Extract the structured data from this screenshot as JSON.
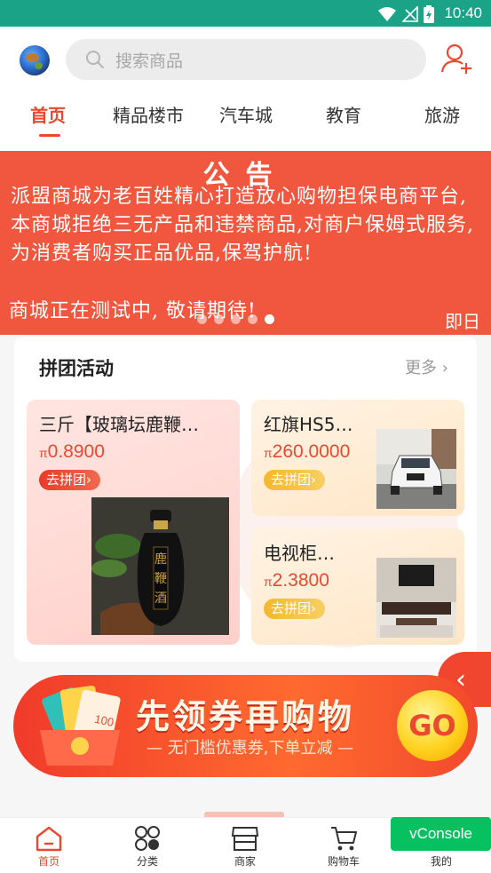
{
  "status_bar": {
    "time": "10:40"
  },
  "header": {
    "search_placeholder": "搜索商品"
  },
  "tabs": [
    {
      "label": "首页",
      "active": true
    },
    {
      "label": "精品楼市"
    },
    {
      "label": "汽车城"
    },
    {
      "label": "教育"
    },
    {
      "label": "旅游"
    }
  ],
  "banner": {
    "title": "公告",
    "text": "派盟商城为老百姓精心打造放心购物担保电商平台,本商城拒绝三无产品和违禁商品,对商户保姆式服务, 为消费者购买正品优品,保驾护航!",
    "text2": "商城正在测试中, 敬请期待!",
    "sign": "即日",
    "slides": 5,
    "active_slide": 5
  },
  "group_buy": {
    "title": "拼团活动",
    "more": "更多",
    "products": [
      {
        "name": "三斤【玻璃坛鹿鞭…",
        "currency": "π",
        "price": "0.8900",
        "button": "去拼团",
        "image_text": "鹿鞭酒"
      },
      {
        "name": "红旗HS5…",
        "currency": "π",
        "price": "260.0000",
        "button": "去拼团"
      },
      {
        "name": "电视柜…",
        "currency": "π",
        "price": "2.3800",
        "button": "去拼团"
      }
    ]
  },
  "coupon_banner": {
    "headline": "先领券再购物",
    "subline": "— 无门槛优惠券,下单立减 —",
    "go": "GO",
    "coupon_value": "100"
  },
  "bottom_nav": [
    {
      "label": "首页",
      "icon": "home-icon",
      "active": true
    },
    {
      "label": "分类",
      "icon": "category-icon"
    },
    {
      "label": "商家",
      "icon": "store-icon"
    },
    {
      "label": "购物车",
      "icon": "cart-icon"
    },
    {
      "label": "我的",
      "icon": "profile-icon"
    }
  ],
  "vconsole": "vConsole",
  "colors": {
    "accent": "#e8492f",
    "status_bar": "#1aa386",
    "vconsole": "#07c160"
  }
}
